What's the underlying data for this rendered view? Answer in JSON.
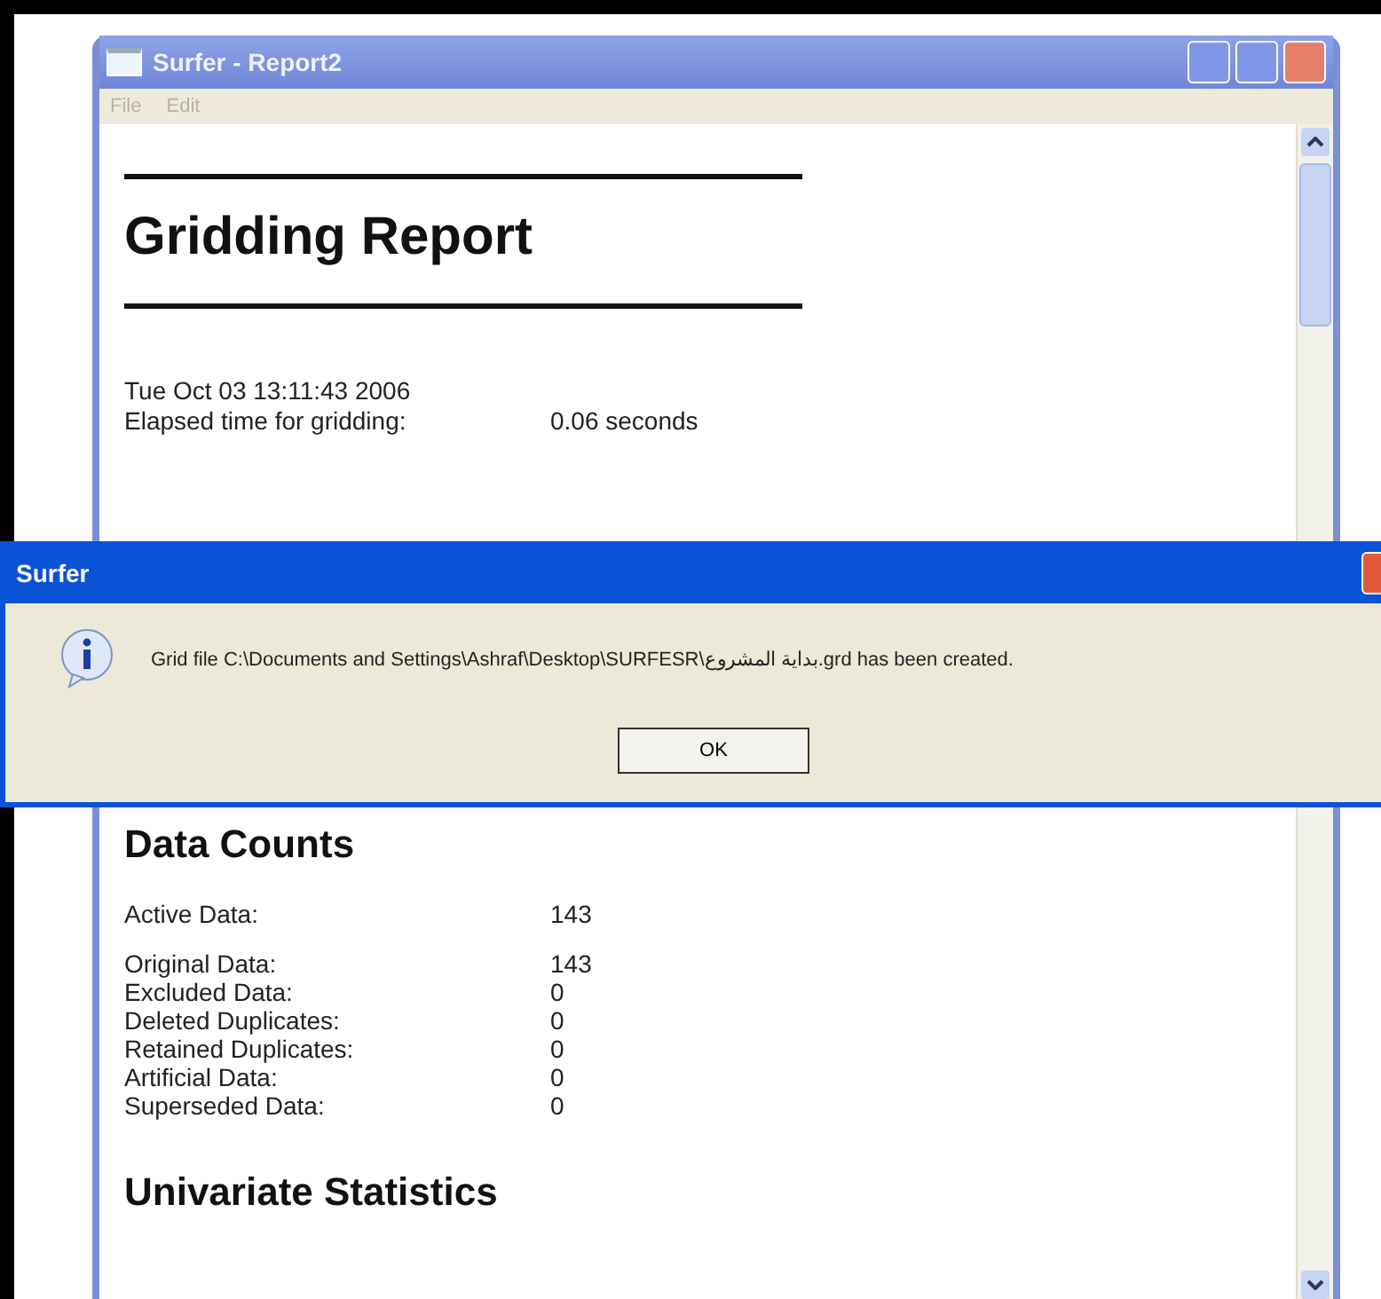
{
  "report_window": {
    "title": "Surfer - Report2",
    "menu": [
      "File",
      "Edit"
    ]
  },
  "report": {
    "title": "Gridding Report",
    "timestamp": "Tue Oct 03 13:11:43 2006",
    "elapsed": {
      "label": "Elapsed time for gridding:",
      "value": "0.06 seconds"
    },
    "sections": [
      {
        "heading": "Data Counts",
        "groups": [
          [
            {
              "label": "Active Data:",
              "value": "143"
            }
          ],
          [
            {
              "label": "Original Data:",
              "value": "143"
            },
            {
              "label": "Excluded Data:",
              "value": "0"
            },
            {
              "label": "Deleted Duplicates:",
              "value": "0"
            },
            {
              "label": "Retained Duplicates:",
              "value": "0"
            },
            {
              "label": "Artificial Data:",
              "value": "0"
            },
            {
              "label": "Superseded Data:",
              "value": "0"
            }
          ]
        ]
      },
      {
        "heading": "Univariate Statistics"
      }
    ]
  },
  "dialog": {
    "title": "Surfer",
    "message": "Grid file C:\\Documents and Settings\\Ashraf\\Desktop\\SURFESR\\بداية المشروع.grd has been created.",
    "button": "OK"
  }
}
